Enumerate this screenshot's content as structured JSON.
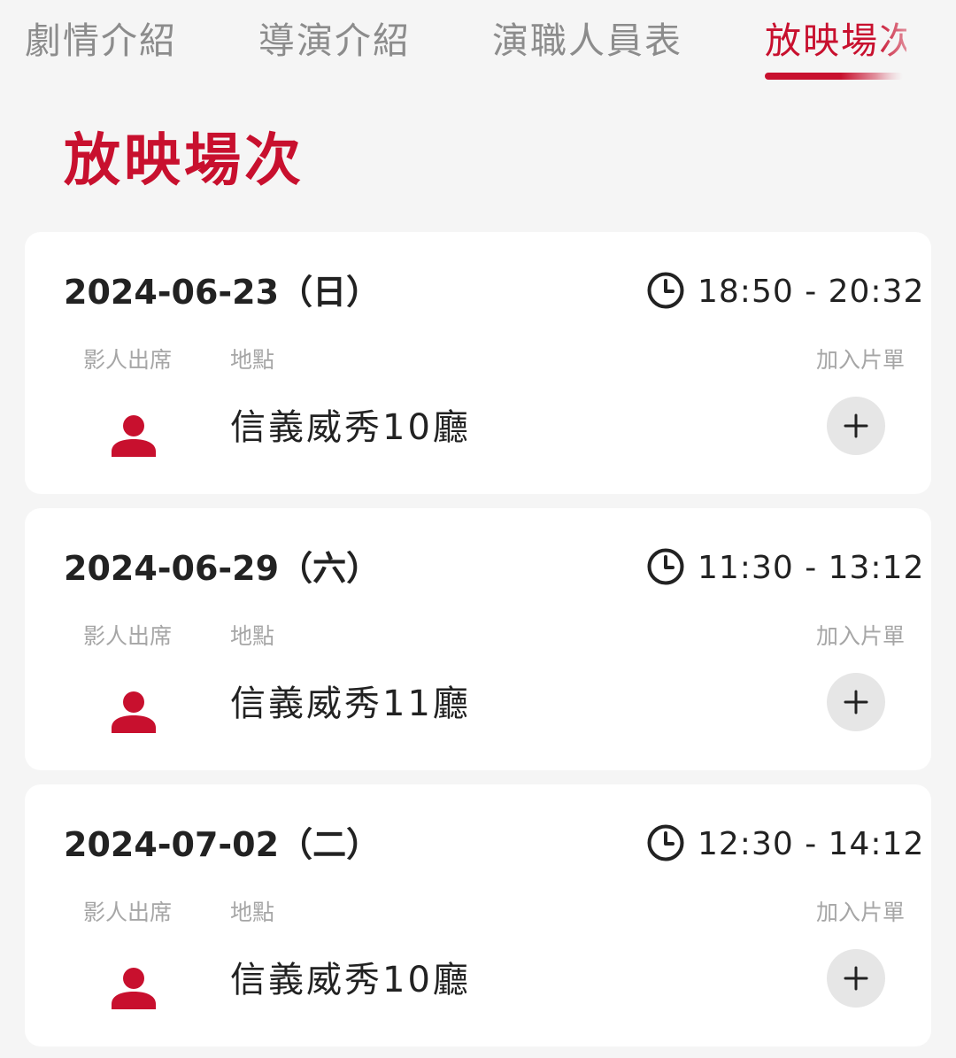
{
  "tabs": [
    {
      "label": "劇情介紹",
      "active": false
    },
    {
      "label": "導演介紹",
      "active": false
    },
    {
      "label": "演職人員表",
      "active": false
    },
    {
      "label": "放映場次",
      "active": true
    }
  ],
  "section": {
    "title": "放映場次"
  },
  "labels": {
    "guest": "影人出席",
    "location": "地點",
    "add": "加入片單"
  },
  "screenings": [
    {
      "date": "2024-06-23（日）",
      "time": "18:50 - 20:32",
      "venue": "信義威秀10廳"
    },
    {
      "date": "2024-06-29（六）",
      "time": "11:30 - 13:12",
      "venue": "信義威秀11廳"
    },
    {
      "date": "2024-07-02（二）",
      "time": "12:30 - 14:12",
      "venue": "信義威秀10廳"
    }
  ],
  "icons": {
    "clock": "clock-icon",
    "person": "person-icon",
    "add": "plus-icon"
  },
  "colors": {
    "accent": "#c8102e",
    "text": "#222222",
    "muted": "#a6a6a6",
    "background": "#f5f5f5",
    "card": "#ffffff"
  }
}
